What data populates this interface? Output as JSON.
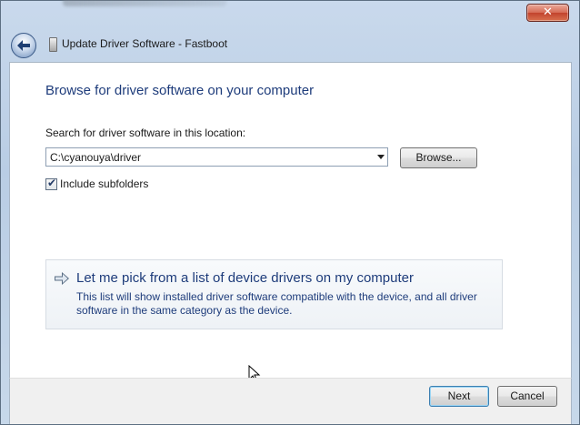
{
  "window": {
    "title": "Update Driver Software - Fastboot",
    "close_glyph": "✕",
    "back_icon": "back-arrow-icon"
  },
  "main": {
    "heading": "Browse for driver software on your computer",
    "search_label": "Search for driver software in this location:",
    "path_value": "C:\\cyanouya\\driver",
    "browse_label": "Browse...",
    "include_subfolders_label": "Include subfolders",
    "include_subfolders_checked": true,
    "check_glyph": "✔"
  },
  "pick_option": {
    "title": "Let me pick from a list of device drivers on my computer",
    "description": "This list will show installed driver software compatible with the device, and all driver software in the same category as the device.",
    "arrow_icon": "green-arrow-icon"
  },
  "footer": {
    "next_label": "Next",
    "cancel_label": "Cancel"
  },
  "colors": {
    "heading": "#1e3c7b",
    "window_frame": "#b9cde4",
    "close_button": "#c2432d"
  }
}
